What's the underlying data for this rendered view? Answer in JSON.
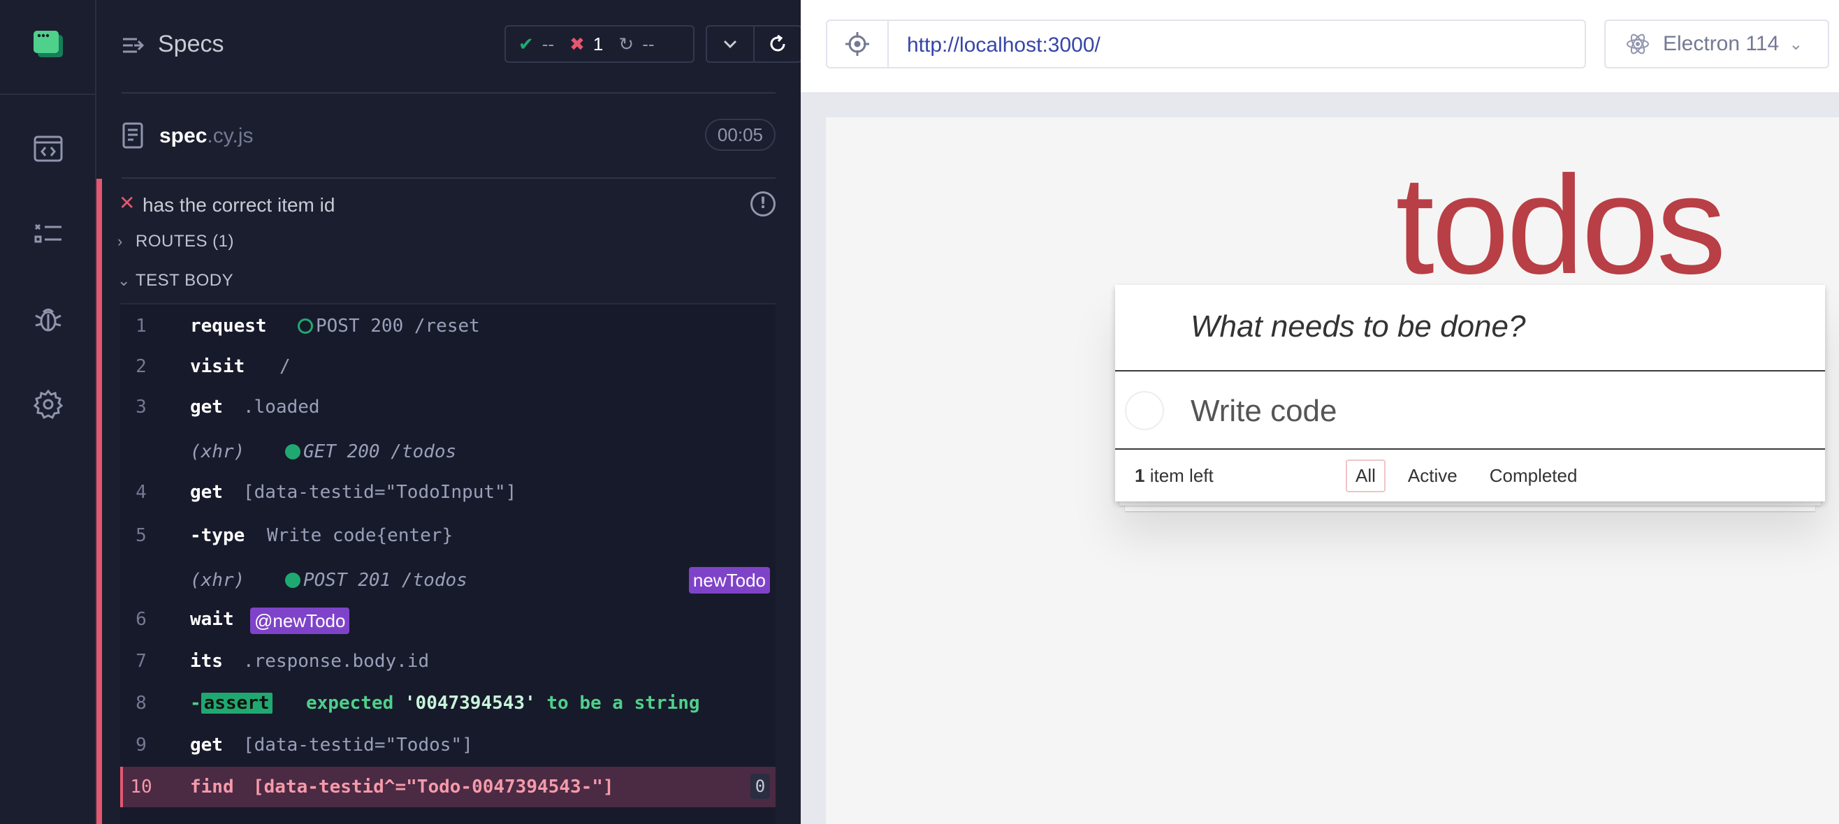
{
  "nav": {
    "items": [
      {
        "name": "specs-nav",
        "icon": "code-window-icon"
      },
      {
        "name": "runs-nav",
        "icon": "checklist-icon"
      },
      {
        "name": "debug-nav",
        "icon": "bug-icon"
      },
      {
        "name": "settings-nav",
        "icon": "gear-icon"
      }
    ]
  },
  "reporter": {
    "title": "Specs",
    "stats": {
      "passed": "--",
      "failed": "1",
      "pending": "--"
    },
    "spec": {
      "base": "spec",
      "ext": ".cy.js",
      "duration": "00:05"
    },
    "test": {
      "title": "has the correct item id",
      "routes_label": "ROUTES (1)",
      "body_label": "TEST BODY"
    },
    "commands": [
      {
        "num": "1",
        "name": "request",
        "message": "POST 200 /reset"
      },
      {
        "num": "2",
        "name": "visit",
        "message": "/"
      },
      {
        "num": "3",
        "name": "get",
        "message": ".loaded"
      },
      {
        "num": "",
        "name": "(xhr)",
        "message": "GET 200 /todos"
      },
      {
        "num": "4",
        "name": "get",
        "message": "[data-testid=\"TodoInput\"]"
      },
      {
        "num": "5",
        "name": "-type",
        "message": "Write code{enter}"
      },
      {
        "num": "",
        "name": "(xhr)",
        "message": "POST 201 /todos",
        "alias": "newTodo"
      },
      {
        "num": "6",
        "name": "wait",
        "alias": "@newTodo"
      },
      {
        "num": "7",
        "name": "its",
        "message": ".response.body.id"
      },
      {
        "num": "8",
        "dash": "-",
        "name": "assert",
        "expected": "expected",
        "value": "'0047394543'",
        "tail": "to be a string"
      },
      {
        "num": "9",
        "name": "get",
        "message": "[data-testid=\"Todos\"]"
      },
      {
        "num": "10",
        "name": "find",
        "message": "[data-testid^=\"Todo-0047394543-\"]",
        "count": "0"
      }
    ]
  },
  "aut": {
    "url": "http://localhost:3000/",
    "browser": "Electron 114",
    "app": {
      "title": "todos",
      "placeholder": "What needs to be done?",
      "items": [
        "Write code"
      ],
      "count": "1",
      "count_suffix": "item left",
      "filters": [
        "All",
        "Active",
        "Completed"
      ],
      "selected_filter": "All"
    }
  },
  "colors": {
    "passed": "#1fa971",
    "failed": "#e45770",
    "alias": "#7f43c9",
    "todo_title": "#b83f45",
    "url": "#3645a8"
  }
}
